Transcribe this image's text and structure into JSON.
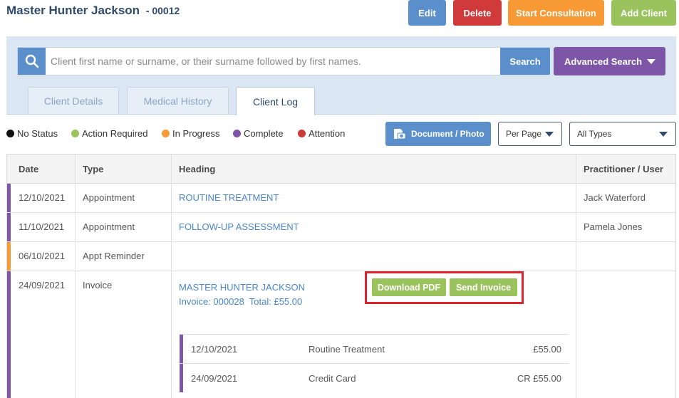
{
  "header": {
    "client_name": "Master Hunter Jackson",
    "client_id": "- 00012",
    "buttons": {
      "edit": "Edit",
      "delete": "Delete",
      "start_consultation": "Start Consultation",
      "add_client": "Add Client"
    }
  },
  "search": {
    "placeholder": "Client first name or surname, or their surname followed by first names.",
    "value": "",
    "search_label": "Search",
    "advanced_label": "Advanced Search"
  },
  "tabs": [
    {
      "label": "Client Details",
      "active": false
    },
    {
      "label": "Medical History",
      "active": false
    },
    {
      "label": "Client Log",
      "active": true
    }
  ],
  "legend": [
    {
      "label": "No Status",
      "color": "#111111"
    },
    {
      "label": "Action Required",
      "color": "#9ac35e"
    },
    {
      "label": "In Progress",
      "color": "#f79a35"
    },
    {
      "label": "Complete",
      "color": "#7d56a8"
    },
    {
      "label": "Attention",
      "color": "#d03a3a"
    }
  ],
  "toolbar": {
    "document_photo": "Document / Photo",
    "per_page": "Per Page",
    "types": "All Types"
  },
  "table": {
    "headers": {
      "date": "Date",
      "type": "Type",
      "heading": "Heading",
      "practitioner": "Practitioner / User"
    },
    "rows": [
      {
        "date": "12/10/2021",
        "type": "Appointment",
        "heading": "ROUTINE TREATMENT",
        "practitioner": "Jack Waterford",
        "status_color": "#7d56a8"
      },
      {
        "date": "11/10/2021",
        "type": "Appointment",
        "heading": "FOLLOW-UP ASSESSMENT",
        "practitioner": "Pamela Jones",
        "status_color": "#7d56a8"
      },
      {
        "date": "06/10/2021",
        "type": "Appt Reminder",
        "heading": "",
        "practitioner": "",
        "status_color": "#f79a35"
      },
      {
        "date": "24/09/2021",
        "type": "Invoice",
        "heading": "MASTER HUNTER JACKSON",
        "invoice_summary": "Invoice: 000028  Total: £55.00",
        "practitioner": "",
        "status_color": "#7d56a8",
        "download_pdf": "Download PDF",
        "send_invoice": "Send Invoice",
        "lines": [
          {
            "date": "12/10/2021",
            "description": "Routine Treatment",
            "amount": "£55.00"
          },
          {
            "date": "24/09/2021",
            "description": "Credit Card",
            "amount": "CR £55.00"
          }
        ]
      }
    ]
  }
}
